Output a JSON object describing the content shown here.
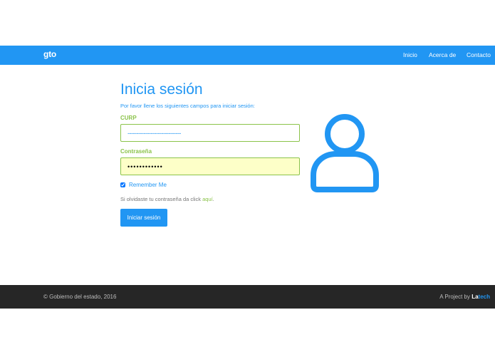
{
  "navbar": {
    "brand": "gto",
    "links": [
      "Inicio",
      "Acerca de",
      "Contacto"
    ],
    "color": "#2196F3"
  },
  "login": {
    "title": "Inicia sesión",
    "subtitle": "Por favor llene los siguientes campos para iniciar sesión:",
    "curp_label": "CURP",
    "curp_placeholder": "------------------------------",
    "password_label": "Contraseña",
    "password_value": "••••••••••••",
    "remember_label": "Remember Me",
    "remember_checked": true,
    "forgot_text": "Si olvidaste tu contraseña da click ",
    "forgot_link": "aquí",
    "forgot_end": ".",
    "submit_label": "Iniciar sesión",
    "avatar_icon": "user-icon",
    "accent_color": "#8BC34A"
  },
  "footer": {
    "copyright": "© Gobierno del estado, 2016",
    "credit_prefix": "A Project by ",
    "credit_brand_a": "La",
    "credit_brand_b": "tech",
    "background": "#262626"
  }
}
